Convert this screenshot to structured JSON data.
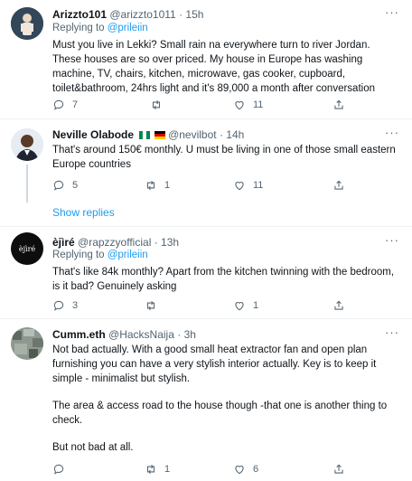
{
  "tweets": [
    {
      "name": "Arizzto101",
      "handle": "@arizzto1011",
      "time": "· 15h",
      "replying_prefix": "Replying to ",
      "replying_to": "@prileiin",
      "text": "Must you live in Lekki? Small rain na everywhere turn to river Jordan. These houses are so over priced. My house in Europe has washing machine, TV, chairs, kitchen, microwave, gas cooker, cupboard, toilet&bathroom, 24hrs light and it's 89,000 a month after conversation",
      "reply_count": "7",
      "retweet_count": "",
      "like_count": "11"
    },
    {
      "name": "Neville Olabode",
      "handle": "@nevilbot",
      "time": "· 14h",
      "text": "That's around 150€ monthly. U must be living in one of those small eastern Europe countries",
      "reply_count": "5",
      "retweet_count": "1",
      "like_count": "11",
      "show_replies": "Show replies"
    },
    {
      "name": "èjìré",
      "handle": "@rapzzyofficial",
      "time": "· 13h",
      "replying_prefix": "Replying to ",
      "replying_to": "@prileiin",
      "text": "That's like 84k monthly? Apart from the kitchen twinning with the bedroom, is it bad? Genuinely asking",
      "reply_count": "3",
      "retweet_count": "",
      "like_count": "1",
      "avatar_text": "èjìré"
    },
    {
      "name": "Cumm.eth",
      "handle": "@HacksNaija",
      "time": "· 3h",
      "text_lines": [
        "Not bad actually. With a good small heat extractor fan and open plan furnishing  you can have a very stylish interior actually. Key is to keep it simple - minimalist but stylish.",
        "The area & access road to the house though -that one is another thing to check.",
        "But not bad at all."
      ],
      "reply_count": "",
      "retweet_count": "1",
      "like_count": "6"
    }
  ],
  "more_glyph": "···",
  "colors": {
    "text": "#0f1419",
    "secondary": "#536471",
    "link": "#1d9bf0",
    "divider": "#eff3f4"
  }
}
